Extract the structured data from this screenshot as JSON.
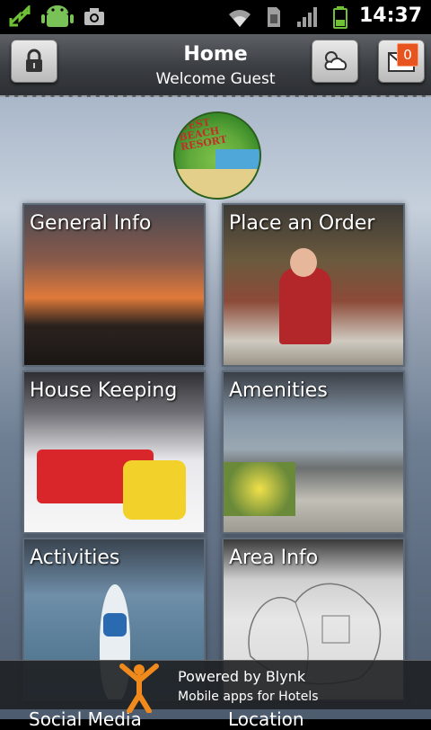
{
  "statusbar": {
    "time": "14:37"
  },
  "header": {
    "title": "Home",
    "subtitle": "Welcome Guest",
    "badge_count": "0"
  },
  "logo": {
    "line1": "WEST",
    "line2": "BEACH",
    "line3": "RESORT"
  },
  "tiles": [
    {
      "label": "General Info"
    },
    {
      "label": "Place an Order"
    },
    {
      "label": "House Keeping"
    },
    {
      "label": "Amenities"
    },
    {
      "label": "Activities"
    },
    {
      "label": "Area Info"
    }
  ],
  "partial_tiles": [
    {
      "label": "Social Media"
    },
    {
      "label": "Location"
    }
  ],
  "footer": {
    "line1": "Powered by Blynk",
    "line2": "Mobile apps for Hotels"
  },
  "colors": {
    "badge": "#e8541f",
    "header_top": "#5d6165",
    "header_bottom": "#2c2f33"
  }
}
